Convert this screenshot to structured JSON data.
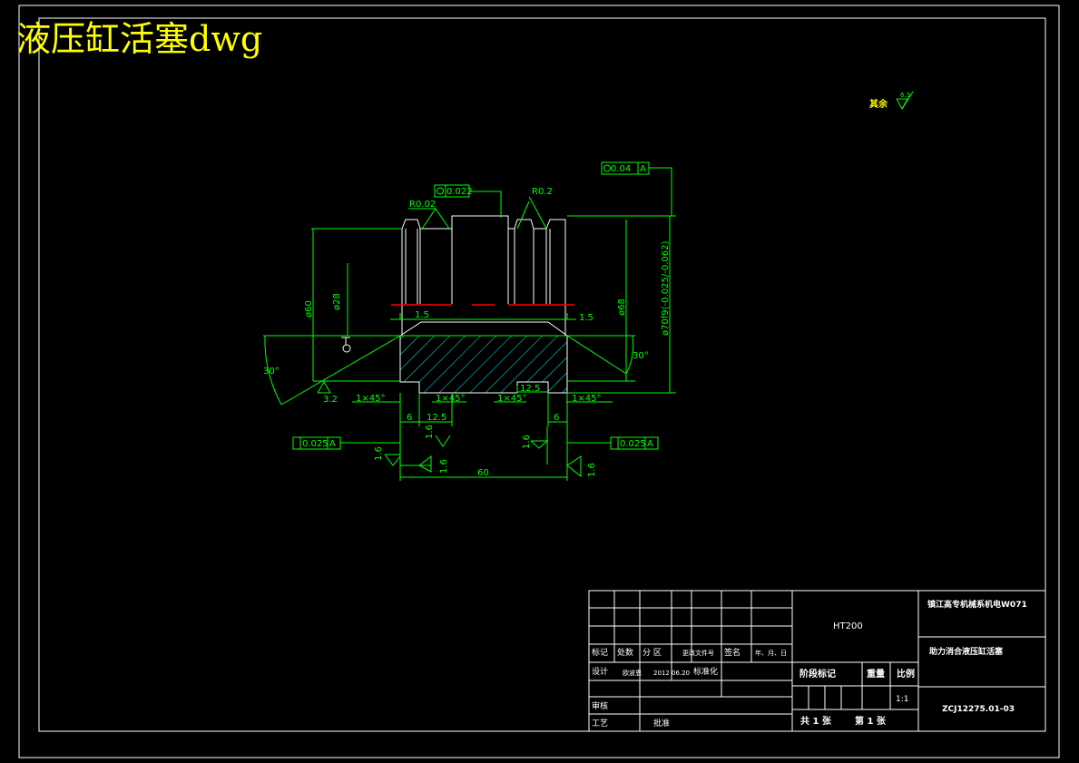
{
  "watermark": "液压缸活塞dwg",
  "roughness_note": {
    "label": "其余",
    "value": "6.3"
  },
  "dimensions": {
    "flatness_top": "0.022",
    "runout_top": "0.04",
    "datum_a": "A",
    "r_left": "R0.02",
    "r_right": "R0.2",
    "d60": "ø60",
    "d28": "ø28",
    "d68": "ø68",
    "d70": "ø70f9(-0.025/-0.062)",
    "ch_left": "1.5",
    "ch_right": "1.5",
    "ang_left": "30°",
    "ang_right": "30°",
    "rough_32": "3.2",
    "c1": "1×45°",
    "c2": "1×45°",
    "c3": "1×45°",
    "c4": "1×45°",
    "w6": "6",
    "w125a": "12.5",
    "w125b": "12.5",
    "w6b": "6",
    "perp_left": "0.025",
    "perp_right": "0.025",
    "r16a": "1.6",
    "r16b": "1.6",
    "r16c": "1.6",
    "r16d": "1.6",
    "r16e": "1.6",
    "len60": "60"
  },
  "title_block": {
    "material": "HT200",
    "school": "镇江高专机械系机电W071",
    "part_name": "助力消合液压缸活塞",
    "drawing_no": "ZCJ12275.01-03",
    "h_mark": "标记",
    "h_count": "处数",
    "h_zone": "分 区",
    "h_doc": "更改文件号",
    "h_sign": "签名",
    "h_date": "年、月、日",
    "design": "设计",
    "designer": "欧波恩",
    "design_date": "2012 06.20",
    "standard": "标准化",
    "review": "审核",
    "process": "工艺",
    "approve": "批准",
    "stage": "阶段标记",
    "weight": "重量",
    "ratio_label": "比例",
    "ratio": "1:1",
    "sheet_total": "共 1 张",
    "sheet_no": "第 1 张"
  }
}
